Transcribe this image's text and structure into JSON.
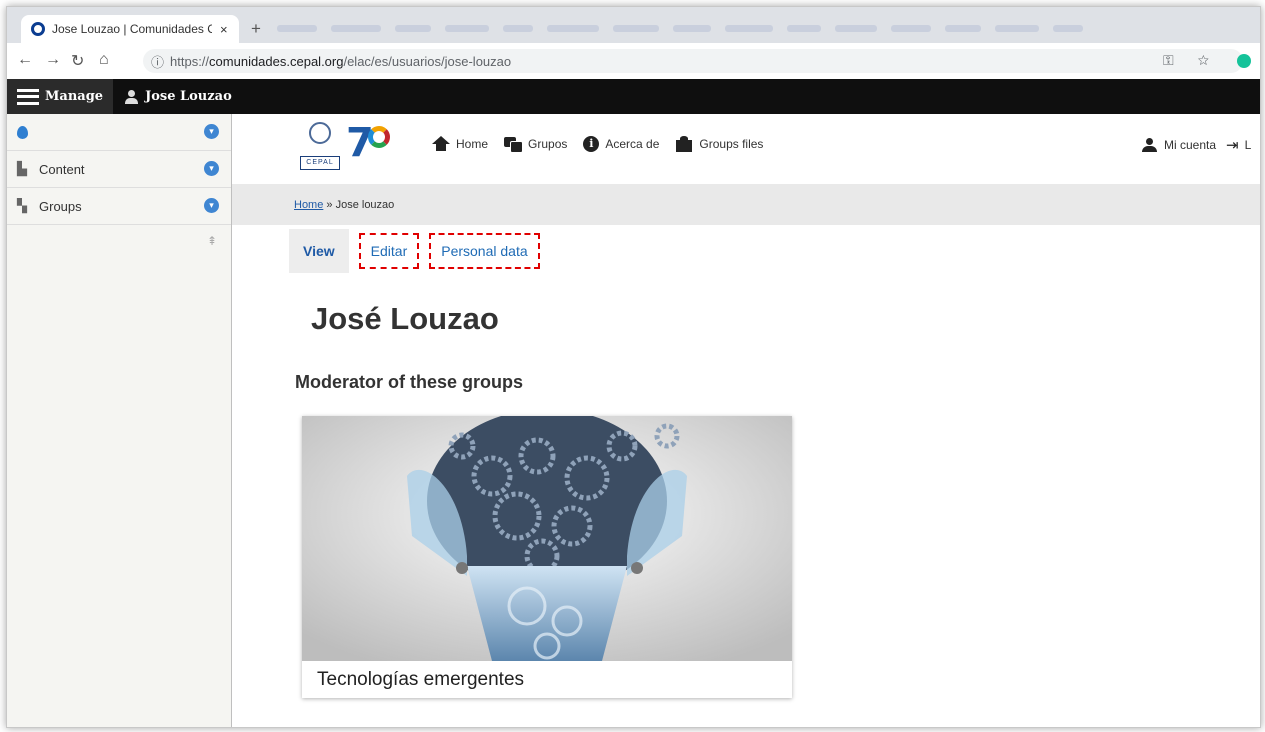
{
  "browser": {
    "tab_title": "Jose Louzao | Comunidades Cepal",
    "tab_close": "×",
    "new_tab": "+",
    "url_proto": "https://",
    "url_host": "comunidades.cepal.org",
    "url_path": "/elac/es/usuarios/jose-louzao",
    "toolbar_right": "⚿ ☆"
  },
  "adminbar": {
    "manage_label": "Manage",
    "user_label": "Jose Louzao"
  },
  "tray": {
    "items": [
      {
        "label": ""
      },
      {
        "label": "Content"
      },
      {
        "label": "Groups"
      }
    ],
    "chevron": "▾"
  },
  "header": {
    "un_word": "CEPAL",
    "seventy": "7",
    "nav": [
      {
        "label": "Home"
      },
      {
        "label": "Grupos"
      },
      {
        "label": "Acerca de"
      },
      {
        "label": "Groups files"
      }
    ],
    "account_label": "Mi cuenta",
    "logout_glyph": "⇥",
    "logout_label": "L"
  },
  "breadcrumb": {
    "home": "Home",
    "separator": " » ",
    "current": "Jose louzao"
  },
  "tabs": [
    {
      "label": "View"
    },
    {
      "label": "Editar"
    },
    {
      "label": "Personal data"
    }
  ],
  "page": {
    "title": "José Louzao",
    "section_title": "Moderator of these groups",
    "group_caption": "Tecnologías emergentes"
  }
}
